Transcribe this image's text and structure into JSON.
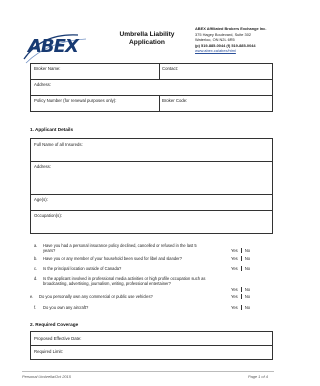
{
  "header": {
    "logo_text": "ABEX",
    "title_line1": "Umbrella Liability",
    "title_line2": "Application",
    "company_name": "ABEX Affiliated Brokers Exchange Inc.",
    "address_line1": "375 Hagey Boulevard, Suite 302",
    "address_line2": "Waterloo, ON N2L 6R5",
    "phone": "(p) 519-885-0044 (f) 519-885-0044",
    "website": "www.abex.ca/abex/html"
  },
  "broker_box": {
    "broker_name": "Broker Name:",
    "contact": "Contact:",
    "address": "Address:",
    "policy_number": "Policy Number (for renewal purposes only):",
    "broker_code": "Broker Code:"
  },
  "section1": {
    "heading": "1.  Applicant Details",
    "full_name": "Full Name of all Insureds:",
    "address": "Address:",
    "ages": "Age(s):",
    "occupations": "Occupation(s):"
  },
  "questions": [
    {
      "letter": "a.",
      "text": "Have you had a personal insurance policy declined, cancelled or refused in the last 5 years?",
      "yes": "Yes",
      "no": "No"
    },
    {
      "letter": "b.",
      "text": "Have you or any member of your household been sued for libel and slander?",
      "yes": "Yes",
      "no": "No"
    },
    {
      "letter": "c.",
      "text": "Is the principal location outside of Canada?",
      "yes": "Yes",
      "no": "No"
    },
    {
      "letter": "d.",
      "text": "Is the applicant involved in professional media activities or high profile occupation such as broadcasting, advertising, journalism, writing, professional entertainer?",
      "yes": "Yes",
      "no": "No"
    },
    {
      "letter": "e.",
      "text": "Do you personally own any commercial or public use vehicles?",
      "yes": "Yes",
      "no": "No"
    },
    {
      "letter": "f.",
      "text": "Do you own any aircraft?",
      "yes": "Yes",
      "no": "No"
    }
  ],
  "section2": {
    "heading": "2.  Required Coverage",
    "effective_date": "Proposed Effective Date:",
    "required_limit": "Required Limit:"
  },
  "footer": {
    "left": "Personal Umbrella/Oct 2015",
    "right": "Page 1 of 4"
  }
}
